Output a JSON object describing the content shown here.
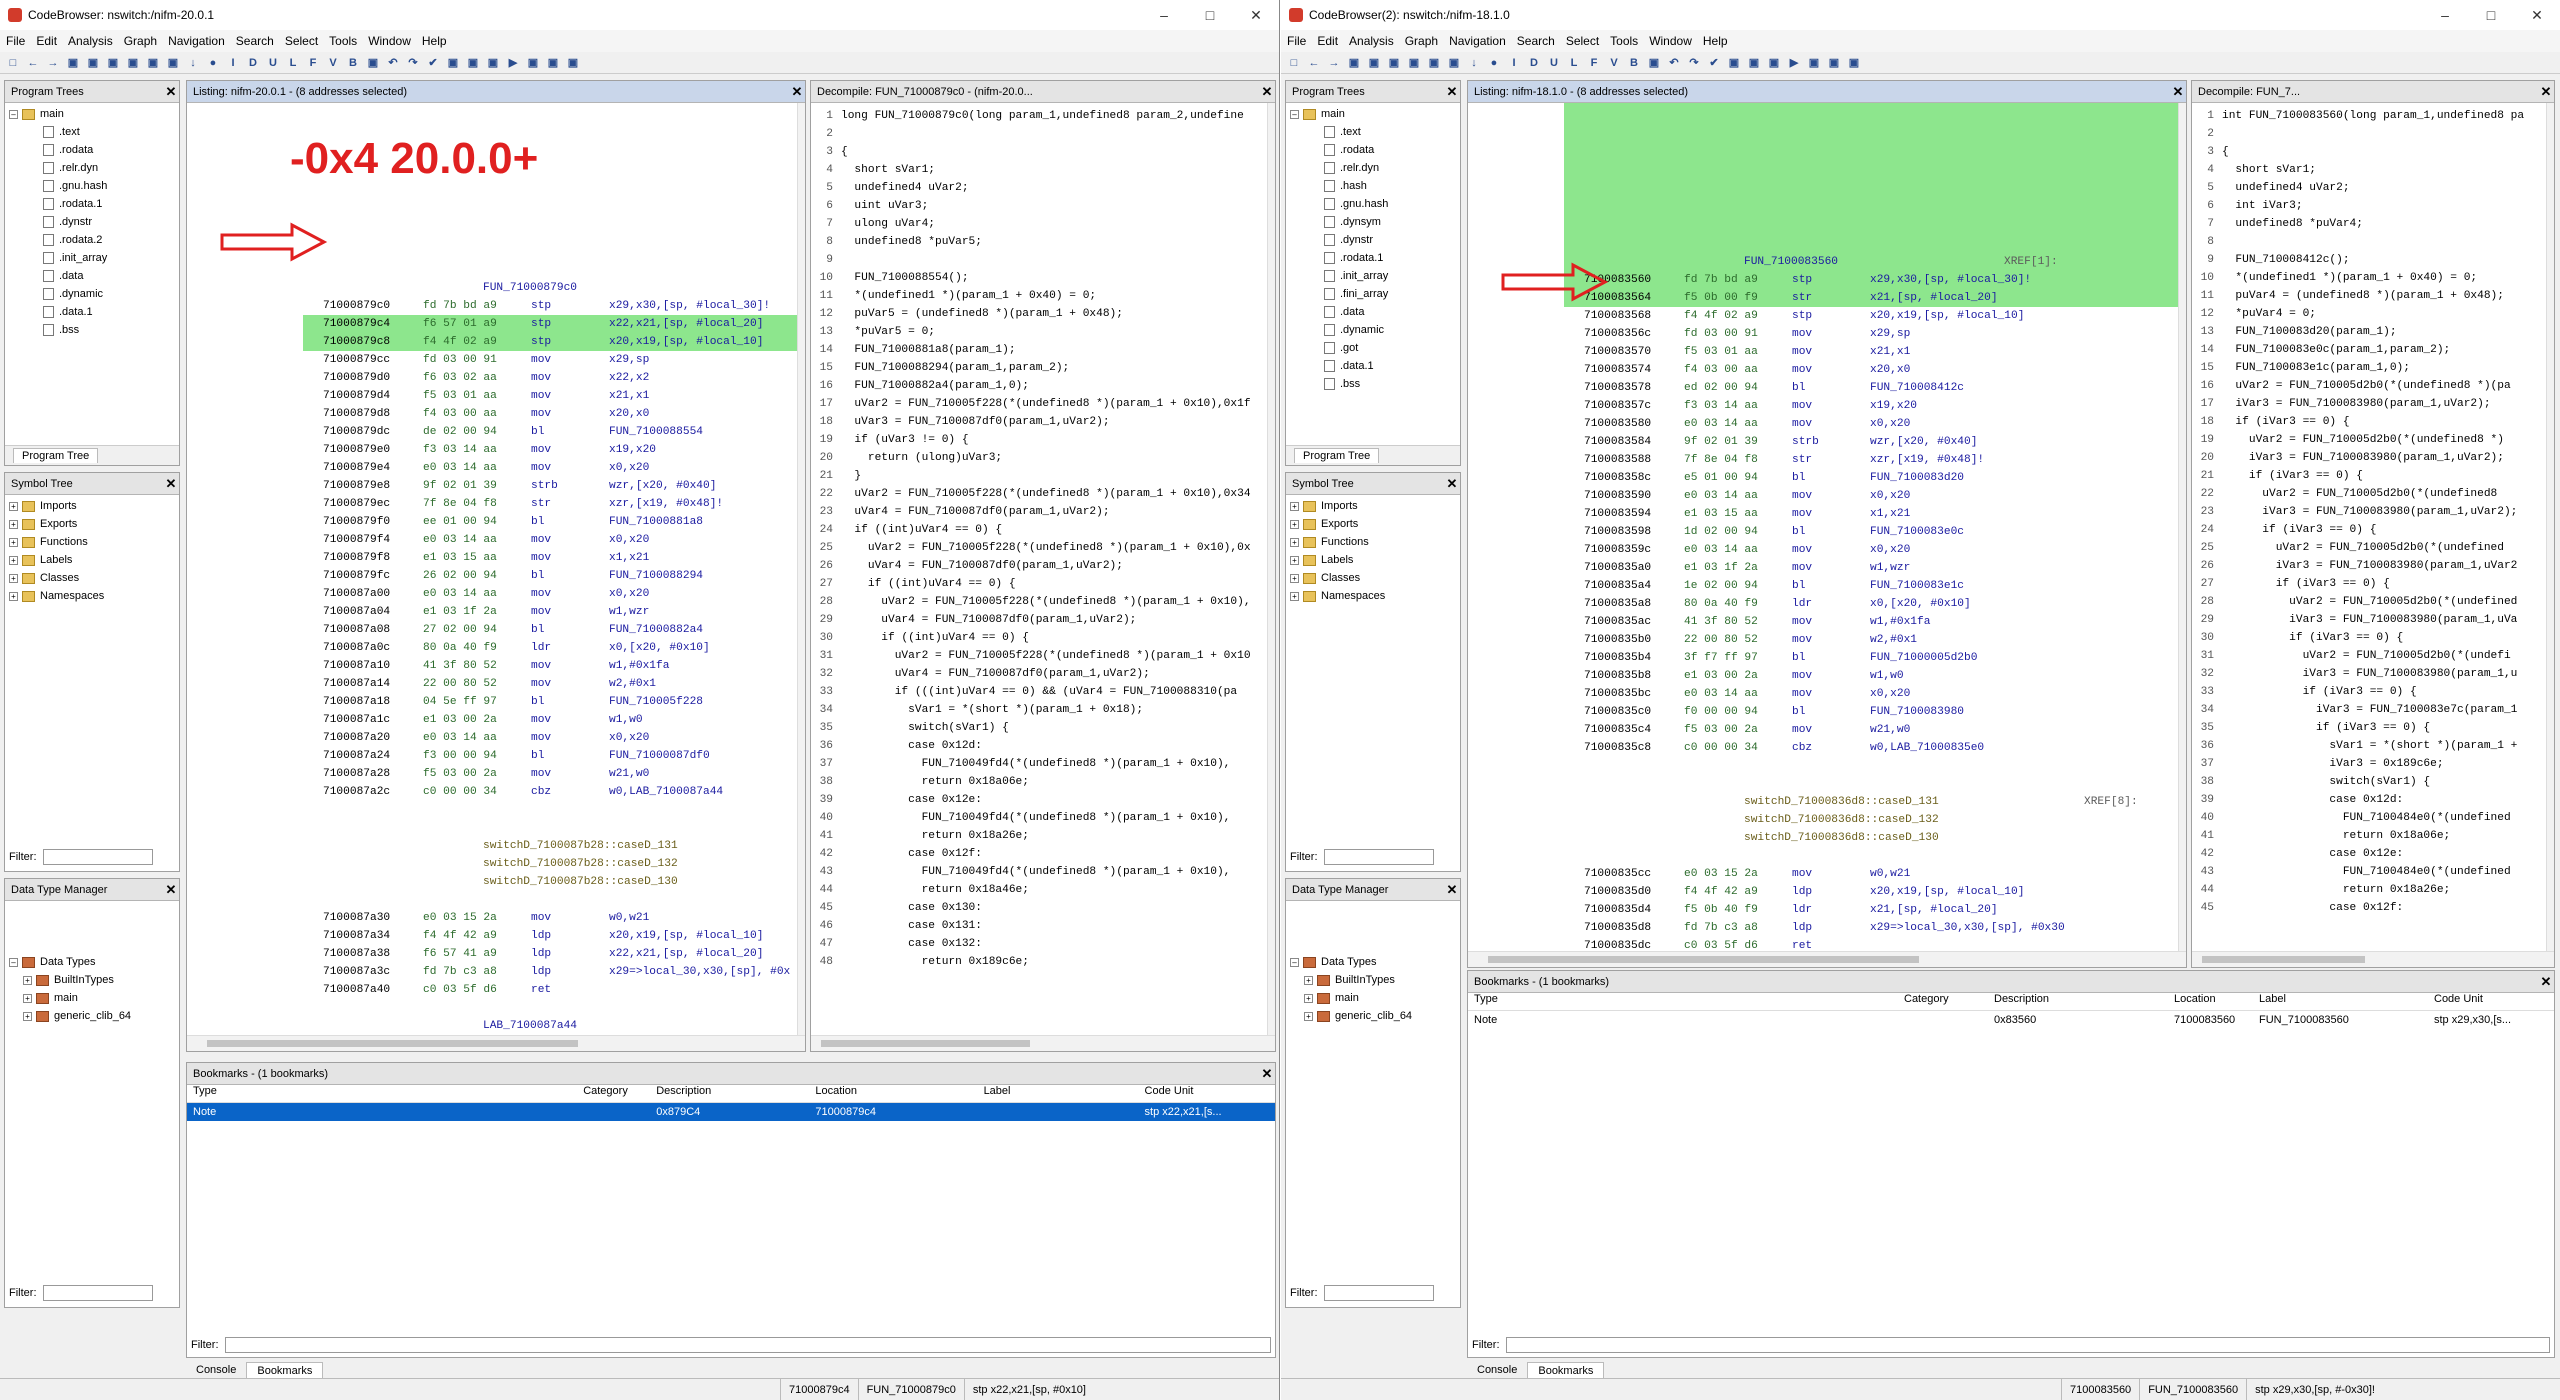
{
  "menus": [
    "File",
    "Edit",
    "Analysis",
    "Graph",
    "Navigation",
    "Search",
    "Select",
    "Tools",
    "Window",
    "Help"
  ],
  "toolbar_glyphs": [
    "□",
    "←",
    "→",
    "▣",
    "▣",
    "▣",
    "▣",
    "▣",
    "▣",
    "↓",
    "●",
    "I",
    "D",
    "U",
    "L",
    "F",
    "V",
    "B",
    "▣",
    "↶",
    "↷",
    "✔",
    "▣",
    "▣",
    "▣",
    "▶",
    "▣",
    "▣",
    "▣"
  ],
  "winA": {
    "title": "CodeBrowser: nswitch:/nifm-20.0.1",
    "program_trees_title": "Program Trees",
    "tree_root": "main",
    "tree_items": [
      ".text",
      ".rodata",
      ".relr.dyn",
      ".gnu.hash",
      ".rodata.1",
      ".dynstr",
      ".rodata.2",
      ".init_array",
      ".data",
      ".dynamic",
      ".data.1",
      ".bss"
    ],
    "program_tree_tab": "Program Tree",
    "symbol_tree_title": "Symbol Tree",
    "symbol_items": [
      "Imports",
      "Exports",
      "Functions",
      "Labels",
      "Classes",
      "Namespaces"
    ],
    "filter_label": "Filter:",
    "dtm_title": "Data Type Manager",
    "dtm_items": [
      "Data Types",
      "BuiltInTypes",
      "main",
      "generic_clib_64"
    ],
    "listing_title": "Listing:  nifm-20.0.1 - (8 addresses selected)",
    "annotation": "-0x4 20.0.0+",
    "listing": [
      {
        "t": "lbl",
        "text": "FUN_71000879c0"
      },
      {
        "t": "ins",
        "addr": "71000879c0",
        "bytes": "fd 7b bd a9",
        "mn": "stp",
        "op": "x29,x30,[sp, #local_30]!"
      },
      {
        "t": "ins",
        "addr": "71000879c4",
        "bytes": "f6 57 01 a9",
        "mn": "stp",
        "op": "x22,x21,[sp, #local_20]",
        "hl": true
      },
      {
        "t": "ins",
        "addr": "71000879c8",
        "bytes": "f4 4f 02 a9",
        "mn": "stp",
        "op": "x20,x19,[sp, #local_10]",
        "hl": true
      },
      {
        "t": "ins",
        "addr": "71000879cc",
        "bytes": "fd 03 00 91",
        "mn": "mov",
        "op": "x29,sp"
      },
      {
        "t": "ins",
        "addr": "71000879d0",
        "bytes": "f6 03 02 aa",
        "mn": "mov",
        "op": "x22,x2"
      },
      {
        "t": "ins",
        "addr": "71000879d4",
        "bytes": "f5 03 01 aa",
        "mn": "mov",
        "op": "x21,x1"
      },
      {
        "t": "ins",
        "addr": "71000879d8",
        "bytes": "f4 03 00 aa",
        "mn": "mov",
        "op": "x20,x0"
      },
      {
        "t": "ins",
        "addr": "71000879dc",
        "bytes": "de 02 00 94",
        "mn": "bl",
        "op": "FUN_7100088554"
      },
      {
        "t": "ins",
        "addr": "71000879e0",
        "bytes": "f3 03 14 aa",
        "mn": "mov",
        "op": "x19,x20"
      },
      {
        "t": "ins",
        "addr": "71000879e4",
        "bytes": "e0 03 14 aa",
        "mn": "mov",
        "op": "x0,x20"
      },
      {
        "t": "ins",
        "addr": "71000879e8",
        "bytes": "9f 02 01 39",
        "mn": "strb",
        "op": "wzr,[x20, #0x40]"
      },
      {
        "t": "ins",
        "addr": "71000879ec",
        "bytes": "7f 8e 04 f8",
        "mn": "str",
        "op": "xzr,[x19, #0x48]!"
      },
      {
        "t": "ins",
        "addr": "71000879f0",
        "bytes": "ee 01 00 94",
        "mn": "bl",
        "op": "FUN_71000881a8"
      },
      {
        "t": "ins",
        "addr": "71000879f4",
        "bytes": "e0 03 14 aa",
        "mn": "mov",
        "op": "x0,x20"
      },
      {
        "t": "ins",
        "addr": "71000879f8",
        "bytes": "e1 03 15 aa",
        "mn": "mov",
        "op": "x1,x21"
      },
      {
        "t": "ins",
        "addr": "71000879fc",
        "bytes": "26 02 00 94",
        "mn": "bl",
        "op": "FUN_7100088294"
      },
      {
        "t": "ins",
        "addr": "7100087a00",
        "bytes": "e0 03 14 aa",
        "mn": "mov",
        "op": "x0,x20"
      },
      {
        "t": "ins",
        "addr": "7100087a04",
        "bytes": "e1 03 1f 2a",
        "mn": "mov",
        "op": "w1,wzr"
      },
      {
        "t": "ins",
        "addr": "7100087a08",
        "bytes": "27 02 00 94",
        "mn": "bl",
        "op": "FUN_71000882a4"
      },
      {
        "t": "ins",
        "addr": "7100087a0c",
        "bytes": "80 0a 40 f9",
        "mn": "ldr",
        "op": "x0,[x20, #0x10]"
      },
      {
        "t": "ins",
        "addr": "7100087a10",
        "bytes": "41 3f 80 52",
        "mn": "mov",
        "op": "w1,#0x1fa"
      },
      {
        "t": "ins",
        "addr": "7100087a14",
        "bytes": "22 00 80 52",
        "mn": "mov",
        "op": "w2,#0x1"
      },
      {
        "t": "ins",
        "addr": "7100087a18",
        "bytes": "04 5e ff 97",
        "mn": "bl",
        "op": "FUN_710005f228"
      },
      {
        "t": "ins",
        "addr": "7100087a1c",
        "bytes": "e1 03 00 2a",
        "mn": "mov",
        "op": "w1,w0"
      },
      {
        "t": "ins",
        "addr": "7100087a20",
        "bytes": "e0 03 14 aa",
        "mn": "mov",
        "op": "x0,x20"
      },
      {
        "t": "ins",
        "addr": "7100087a24",
        "bytes": "f3 00 00 94",
        "mn": "bl",
        "op": "FUN_71000087df0"
      },
      {
        "t": "ins",
        "addr": "7100087a28",
        "bytes": "f5 03 00 2a",
        "mn": "mov",
        "op": "w21,w0"
      },
      {
        "t": "ins",
        "addr": "7100087a2c",
        "bytes": "c0 00 00 34",
        "mn": "cbz",
        "op": "w0,LAB_7100087a44"
      },
      {
        "t": "blank"
      },
      {
        "t": "blank"
      },
      {
        "t": "case",
        "text": "switchD_7100087b28::caseD_131"
      },
      {
        "t": "case",
        "text": "switchD_7100087b28::caseD_132"
      },
      {
        "t": "case",
        "text": "switchD_7100087b28::caseD_130"
      },
      {
        "t": "blank"
      },
      {
        "t": "ins",
        "addr": "7100087a30",
        "bytes": "e0 03 15 2a",
        "mn": "mov",
        "op": "w0,w21"
      },
      {
        "t": "ins",
        "addr": "7100087a34",
        "bytes": "f4 4f 42 a9",
        "mn": "ldp",
        "op": "x20,x19,[sp, #local_10]"
      },
      {
        "t": "ins",
        "addr": "7100087a38",
        "bytes": "f6 57 41 a9",
        "mn": "ldp",
        "op": "x22,x21,[sp, #local_20]"
      },
      {
        "t": "ins",
        "addr": "7100087a3c",
        "bytes": "fd 7b c3 a8",
        "mn": "ldp",
        "op": "x29=>local_30,x30,[sp], #0x"
      },
      {
        "t": "ins",
        "addr": "7100087a40",
        "bytes": "c0 03 5f d6",
        "mn": "ret",
        "op": ""
      },
      {
        "t": "blank"
      },
      {
        "t": "lbl2",
        "text": "LAB_7100087a44"
      },
      {
        "t": "ins",
        "addr": "7100087a44",
        "bytes": "80 0a 40 f9",
        "mn": "ldr",
        "op": "x0,[x20, #0x10]"
      },
      {
        "t": "ins",
        "addr": "7100087a48",
        "bytes": "81 06 80 52",
        "mn": "mov",
        "op": "w1,#0x34"
      },
      {
        "t": "ins",
        "addr": "7100087a4c",
        "bytes": "e2 03 1f 2a",
        "mn": "mov",
        "op": "w2,wzr"
      },
      {
        "t": "ins",
        "addr": "7100087a50",
        "bytes": "f6 5d ff 97",
        "mn": "bl",
        "op": "FUN_710005f228"
      },
      {
        "t": "ins",
        "addr": "7100087a54",
        "bytes": "e1 03 00 2a",
        "mn": "mov",
        "op": "w1,w0"
      },
      {
        "t": "ins",
        "addr": "7100087a58",
        "bytes": "e0 03 14 aa",
        "mn": "mov",
        "op": "x0,x20"
      },
      {
        "t": "ins",
        "addr": "7100087a5c",
        "bytes": "e5 00 00 94",
        "mn": "bl",
        "op": "FUN_71000087df0"
      }
    ],
    "decompile_title": "Decompile: FUN_71000879c0 - (nifm-20.0...",
    "decompile": [
      "long FUN_71000879c0(long param_1,undefined8 param_2,undefine",
      "",
      "{",
      "  short sVar1;",
      "  undefined4 uVar2;",
      "  uint uVar3;",
      "  ulong uVar4;",
      "  undefined8 *puVar5;",
      "",
      "  FUN_7100088554();",
      "  *(undefined1 *)(param_1 + 0x40) = 0;",
      "  puVar5 = (undefined8 *)(param_1 + 0x48);",
      "  *puVar5 = 0;",
      "  FUN_71000881a8(param_1);",
      "  FUN_7100088294(param_1,param_2);",
      "  FUN_71000882a4(param_1,0);",
      "  uVar2 = FUN_710005f228(*(undefined8 *)(param_1 + 0x10),0x1f",
      "  uVar3 = FUN_7100087df0(param_1,uVar2);",
      "  if (uVar3 != 0) {",
      "    return (ulong)uVar3;",
      "  }",
      "  uVar2 = FUN_710005f228(*(undefined8 *)(param_1 + 0x10),0x34",
      "  uVar4 = FUN_7100087df0(param_1,uVar2);",
      "  if ((int)uVar4 == 0) {",
      "    uVar2 = FUN_710005f228(*(undefined8 *)(param_1 + 0x10),0x",
      "    uVar4 = FUN_7100087df0(param_1,uVar2);",
      "    if ((int)uVar4 == 0) {",
      "      uVar2 = FUN_710005f228(*(undefined8 *)(param_1 + 0x10),",
      "      uVar4 = FUN_7100087df0(param_1,uVar2);",
      "      if ((int)uVar4 == 0) {",
      "        uVar2 = FUN_710005f228(*(undefined8 *)(param_1 + 0x10",
      "        uVar4 = FUN_7100087df0(param_1,uVar2);",
      "        if (((int)uVar4 == 0) && (uVar4 = FUN_7100088310(pa",
      "          sVar1 = *(short *)(param_1 + 0x18);",
      "          switch(sVar1) {",
      "          case 0x12d:",
      "            FUN_710049fd4(*(undefined8 *)(param_1 + 0x10),",
      "            return 0x18a06e;",
      "          case 0x12e:",
      "            FUN_710049fd4(*(undefined8 *)(param_1 + 0x10),",
      "            return 0x18a26e;",
      "          case 0x12f:",
      "            FUN_710049fd4(*(undefined8 *)(param_1 + 0x10),",
      "            return 0x18a46e;",
      "          case 0x130:",
      "          case 0x131:",
      "          case 0x132:",
      "            return 0x189c6e;"
    ],
    "bookmarks_title": "Bookmarks - (1 bookmarks)",
    "bm_headers": [
      "Type",
      "Category",
      "Description",
      "Location",
      "Label",
      "Code Unit"
    ],
    "bm_row": [
      "Note",
      "",
      "0x879C4",
      "71000879c4",
      "",
      "stp x22,x21,[s..."
    ],
    "console_tab": "Console",
    "bookmarks_tab": "Bookmarks",
    "status": [
      "71000879c4",
      "FUN_71000879c0",
      "stp x22,x21,[sp, #0x10]"
    ]
  },
  "winB": {
    "title": "CodeBrowser(2): nswitch:/nifm-18.1.0",
    "program_trees_title": "Program Trees",
    "tree_root": "main",
    "tree_items": [
      ".text",
      ".rodata",
      ".relr.dyn",
      ".hash",
      ".gnu.hash",
      ".dynsym",
      ".dynstr",
      ".rodata.1",
      ".init_array",
      ".fini_array",
      ".data",
      ".dynamic",
      ".got",
      ".data.1",
      ".bss"
    ],
    "program_tree_tab": "Program Tree",
    "symbol_tree_title": "Symbol Tree",
    "symbol_items": [
      "Imports",
      "Exports",
      "Functions",
      "Labels",
      "Classes",
      "Namespaces"
    ],
    "filter_label": "Filter:",
    "dtm_title": "Data Type Manager",
    "dtm_items": [
      "Data Types",
      "BuiltInTypes",
      "main",
      "generic_clib_64"
    ],
    "listing_title": "Listing:  nifm-18.1.0 - (8 addresses selected)",
    "listing": [
      {
        "t": "lblx",
        "text": "FUN_7100083560",
        "xref": "XREF[1]:"
      },
      {
        "t": "ins",
        "addr": "7100083560",
        "bytes": "fd 7b bd a9",
        "mn": "stp",
        "op": "x29,x30,[sp, #local_30]!",
        "hl": true
      },
      {
        "t": "ins",
        "addr": "7100083564",
        "bytes": "f5 0b 00 f9",
        "mn": "str",
        "op": "x21,[sp, #local_20]",
        "hl": true
      },
      {
        "t": "ins",
        "addr": "7100083568",
        "bytes": "f4 4f 02 a9",
        "mn": "stp",
        "op": "x20,x19,[sp, #local_10]"
      },
      {
        "t": "ins",
        "addr": "710008356c",
        "bytes": "fd 03 00 91",
        "mn": "mov",
        "op": "x29,sp"
      },
      {
        "t": "ins",
        "addr": "7100083570",
        "bytes": "f5 03 01 aa",
        "mn": "mov",
        "op": "x21,x1"
      },
      {
        "t": "ins",
        "addr": "7100083574",
        "bytes": "f4 03 00 aa",
        "mn": "mov",
        "op": "x20,x0"
      },
      {
        "t": "ins",
        "addr": "7100083578",
        "bytes": "ed 02 00 94",
        "mn": "bl",
        "op": "FUN_710008412c"
      },
      {
        "t": "ins",
        "addr": "710008357c",
        "bytes": "f3 03 14 aa",
        "mn": "mov",
        "op": "x19,x20"
      },
      {
        "t": "ins",
        "addr": "7100083580",
        "bytes": "e0 03 14 aa",
        "mn": "mov",
        "op": "x0,x20"
      },
      {
        "t": "ins",
        "addr": "7100083584",
        "bytes": "9f 02 01 39",
        "mn": "strb",
        "op": "wzr,[x20, #0x40]"
      },
      {
        "t": "ins",
        "addr": "7100083588",
        "bytes": "7f 8e 04 f8",
        "mn": "str",
        "op": "xzr,[x19, #0x48]!"
      },
      {
        "t": "ins",
        "addr": "710008358c",
        "bytes": "e5 01 00 94",
        "mn": "bl",
        "op": "FUN_7100083d20"
      },
      {
        "t": "ins",
        "addr": "7100083590",
        "bytes": "e0 03 14 aa",
        "mn": "mov",
        "op": "x0,x20"
      },
      {
        "t": "ins",
        "addr": "7100083594",
        "bytes": "e1 03 15 aa",
        "mn": "mov",
        "op": "x1,x21"
      },
      {
        "t": "ins",
        "addr": "7100083598",
        "bytes": "1d 02 00 94",
        "mn": "bl",
        "op": "FUN_7100083e0c"
      },
      {
        "t": "ins",
        "addr": "710008359c",
        "bytes": "e0 03 14 aa",
        "mn": "mov",
        "op": "x0,x20"
      },
      {
        "t": "ins",
        "addr": "71000835a0",
        "bytes": "e1 03 1f 2a",
        "mn": "mov",
        "op": "w1,wzr"
      },
      {
        "t": "ins",
        "addr": "71000835a4",
        "bytes": "1e 02 00 94",
        "mn": "bl",
        "op": "FUN_7100083e1c"
      },
      {
        "t": "ins",
        "addr": "71000835a8",
        "bytes": "80 0a 40 f9",
        "mn": "ldr",
        "op": "x0,[x20, #0x10]"
      },
      {
        "t": "ins",
        "addr": "71000835ac",
        "bytes": "41 3f 80 52",
        "mn": "mov",
        "op": "w1,#0x1fa"
      },
      {
        "t": "ins",
        "addr": "71000835b0",
        "bytes": "22 00 80 52",
        "mn": "mov",
        "op": "w2,#0x1"
      },
      {
        "t": "ins",
        "addr": "71000835b4",
        "bytes": "3f f7 ff 97",
        "mn": "bl",
        "op": "FUN_71000005d2b0"
      },
      {
        "t": "ins",
        "addr": "71000835b8",
        "bytes": "e1 03 00 2a",
        "mn": "mov",
        "op": "w1,w0"
      },
      {
        "t": "ins",
        "addr": "71000835bc",
        "bytes": "e0 03 14 aa",
        "mn": "mov",
        "op": "x0,x20"
      },
      {
        "t": "ins",
        "addr": "71000835c0",
        "bytes": "f0 00 00 94",
        "mn": "bl",
        "op": "FUN_7100083980"
      },
      {
        "t": "ins",
        "addr": "71000835c4",
        "bytes": "f5 03 00 2a",
        "mn": "mov",
        "op": "w21,w0"
      },
      {
        "t": "ins",
        "addr": "71000835c8",
        "bytes": "c0 00 00 34",
        "mn": "cbz",
        "op": "w0,LAB_71000835e0"
      },
      {
        "t": "blank"
      },
      {
        "t": "blank"
      },
      {
        "t": "casex",
        "text": "switchD_71000836d8::caseD_131",
        "xref": "XREF[8]:"
      },
      {
        "t": "case",
        "text": "switchD_71000836d8::caseD_132"
      },
      {
        "t": "case",
        "text": "switchD_71000836d8::caseD_130"
      },
      {
        "t": "blank"
      },
      {
        "t": "ins",
        "addr": "71000835cc",
        "bytes": "e0 03 15 2a",
        "mn": "mov",
        "op": "w0,w21"
      },
      {
        "t": "ins",
        "addr": "71000835d0",
        "bytes": "f4 4f 42 a9",
        "mn": "ldp",
        "op": "x20,x19,[sp, #local_10]"
      },
      {
        "t": "ins",
        "addr": "71000835d4",
        "bytes": "f5 0b 40 f9",
        "mn": "ldr",
        "op": "x21,[sp, #local_20]"
      },
      {
        "t": "ins",
        "addr": "71000835d8",
        "bytes": "fd 7b c3 a8",
        "mn": "ldp",
        "op": "x29=>local_30,x30,[sp], #0x30"
      },
      {
        "t": "ins",
        "addr": "71000835dc",
        "bytes": "c0 03 5f d6",
        "mn": "ret",
        "op": ""
      }
    ],
    "decompile_title": "Decompile: FUN_7...",
    "decompile": [
      "int FUN_7100083560(long param_1,undefined8 pa",
      "",
      "{",
      "  short sVar1;",
      "  undefined4 uVar2;",
      "  int iVar3;",
      "  undefined8 *puVar4;",
      "",
      "  FUN_710008412c();",
      "  *(undefined1 *)(param_1 + 0x40) = 0;",
      "  puVar4 = (undefined8 *)(param_1 + 0x48);",
      "  *puVar4 = 0;",
      "  FUN_7100083d20(param_1);",
      "  FUN_7100083e0c(param_1,param_2);",
      "  FUN_7100083e1c(param_1,0);",
      "  uVar2 = FUN_710005d2b0(*(undefined8 *)(pa",
      "  iVar3 = FUN_7100083980(param_1,uVar2);",
      "  if (iVar3 == 0) {",
      "    uVar2 = FUN_710005d2b0(*(undefined8 *)",
      "    iVar3 = FUN_7100083980(param_1,uVar2);",
      "    if (iVar3 == 0) {",
      "      uVar2 = FUN_710005d2b0(*(undefined8",
      "      iVar3 = FUN_7100083980(param_1,uVar2);",
      "      if (iVar3 == 0) {",
      "        uVar2 = FUN_710005d2b0(*(undefined",
      "        iVar3 = FUN_7100083980(param_1,uVar2",
      "        if (iVar3 == 0) {",
      "          uVar2 = FUN_710005d2b0(*(undefined",
      "          iVar3 = FUN_7100083980(param_1,uVa",
      "          if (iVar3 == 0) {",
      "            uVar2 = FUN_710005d2b0(*(undefi",
      "            iVar3 = FUN_7100083980(param_1,u",
      "            if (iVar3 == 0) {",
      "              iVar3 = FUN_7100083e7c(param_1",
      "              if (iVar3 == 0) {",
      "                sVar1 = *(short *)(param_1 +",
      "                iVar3 = 0x189c6e;",
      "                switch(sVar1) {",
      "                case 0x12d:",
      "                  FUN_7100484e0(*(undefined",
      "                  return 0x18a06e;",
      "                case 0x12e:",
      "                  FUN_7100484e0(*(undefined",
      "                  return 0x18a26e;",
      "                case 0x12f:"
    ],
    "bookmarks_title": "Bookmarks - (1 bookmarks)",
    "bm_headers": [
      "Type",
      "Category",
      "Description",
      "Location",
      "Label",
      "Code Unit"
    ],
    "bm_row": [
      "Note",
      "",
      "0x83560",
      "7100083560",
      "FUN_7100083560",
      "stp x29,x30,[s..."
    ],
    "console_tab": "Console",
    "bookmarks_tab": "Bookmarks",
    "status": [
      "7100083560",
      "FUN_7100083560",
      "stp x29,x30,[sp, #-0x30]!"
    ]
  },
  "colors": {
    "highlight": "#8de68d",
    "arrow": "#e02020",
    "selected_row": "#0a64c8"
  }
}
